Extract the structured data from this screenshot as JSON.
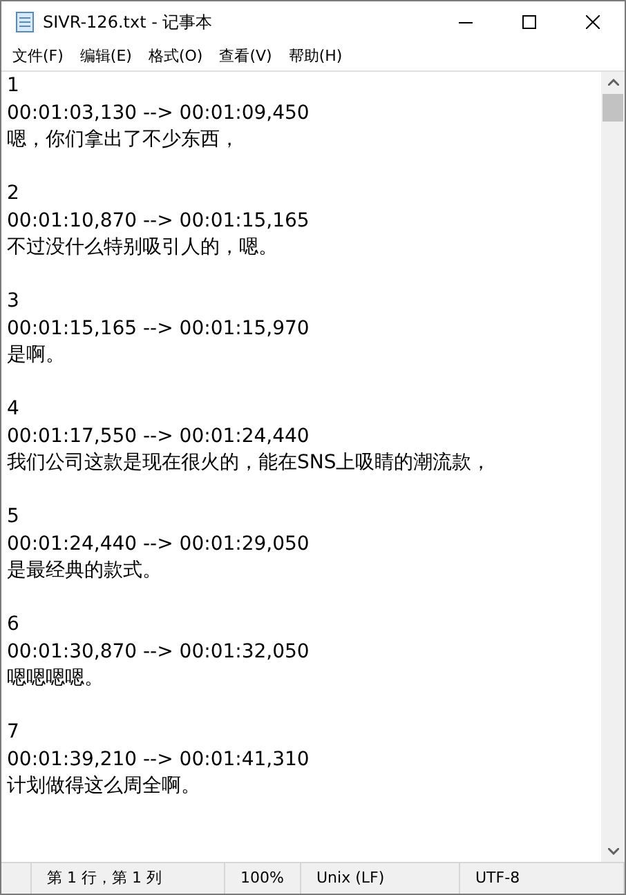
{
  "window": {
    "title": "SIVR-126.txt - 记事本"
  },
  "menu": [
    "文件(F)",
    "编辑(E)",
    "格式(O)",
    "查看(V)",
    "帮助(H)"
  ],
  "entries": [
    {
      "index": "1",
      "time": "00:01:03,130 --> 00:01:09,450",
      "text": "嗯，你们拿出了不少东西，"
    },
    {
      "index": "2",
      "time": "00:01:10,870 --> 00:01:15,165",
      "text": "不过没什么特别吸引人的，嗯。"
    },
    {
      "index": "3",
      "time": "00:01:15,165 --> 00:01:15,970",
      "text": "是啊。"
    },
    {
      "index": "4",
      "time": "00:01:17,550 --> 00:01:24,440",
      "text": "我们公司这款是现在很火的，能在SNS上吸睛的潮流款，"
    },
    {
      "index": "5",
      "time": "00:01:24,440 --> 00:01:29,050",
      "text": "是最经典的款式。"
    },
    {
      "index": "6",
      "time": "00:01:30,870 --> 00:01:32,050",
      "text": "嗯嗯嗯嗯。"
    },
    {
      "index": "7",
      "time": "00:01:39,210 --> 00:01:41,310",
      "text": "计划做得这么周全啊。"
    }
  ],
  "status_bar": [
    "第 1 行，第 1 列",
    "100%",
    "Unix (LF)",
    "UTF-8"
  ]
}
